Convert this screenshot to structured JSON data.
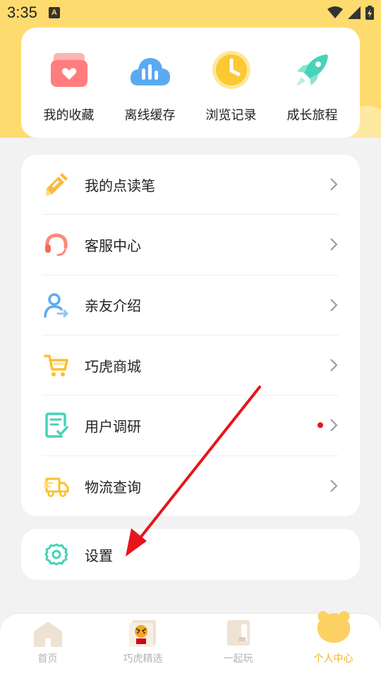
{
  "status_bar": {
    "time": "3:35",
    "notification_badge": "A"
  },
  "quick_actions": [
    {
      "label": "我的收藏",
      "icon": "favorites-icon"
    },
    {
      "label": "离线缓存",
      "icon": "offline-cache-icon"
    },
    {
      "label": "浏览记录",
      "icon": "history-icon"
    },
    {
      "label": "成长旅程",
      "icon": "rocket-icon"
    }
  ],
  "menu": {
    "items": [
      {
        "label": "我的点读笔",
        "icon": "pen-icon"
      },
      {
        "label": "客服中心",
        "icon": "headset-icon"
      },
      {
        "label": "亲友介绍",
        "icon": "refer-friend-icon"
      },
      {
        "label": "巧虎商城",
        "icon": "shopping-cart-icon"
      },
      {
        "label": "用户调研",
        "icon": "survey-icon",
        "has_red_dot": true
      },
      {
        "label": "物流查询",
        "icon": "delivery-truck-icon"
      }
    ]
  },
  "settings": {
    "label": "设置",
    "icon": "gear-icon"
  },
  "tabs": [
    {
      "label": "首页",
      "icon": "home-icon",
      "active": false
    },
    {
      "label": "巧虎精选",
      "icon": "qiaohu-picks-icon",
      "active": false
    },
    {
      "label": "一起玩",
      "icon": "play-together-icon",
      "active": false
    },
    {
      "label": "个人中心",
      "icon": "bear-profile-icon",
      "active": true
    }
  ],
  "colors": {
    "header_yellow": "#fedb6e",
    "active_tab": "#f2b21e",
    "annotation_arrow": "#e8141c"
  }
}
